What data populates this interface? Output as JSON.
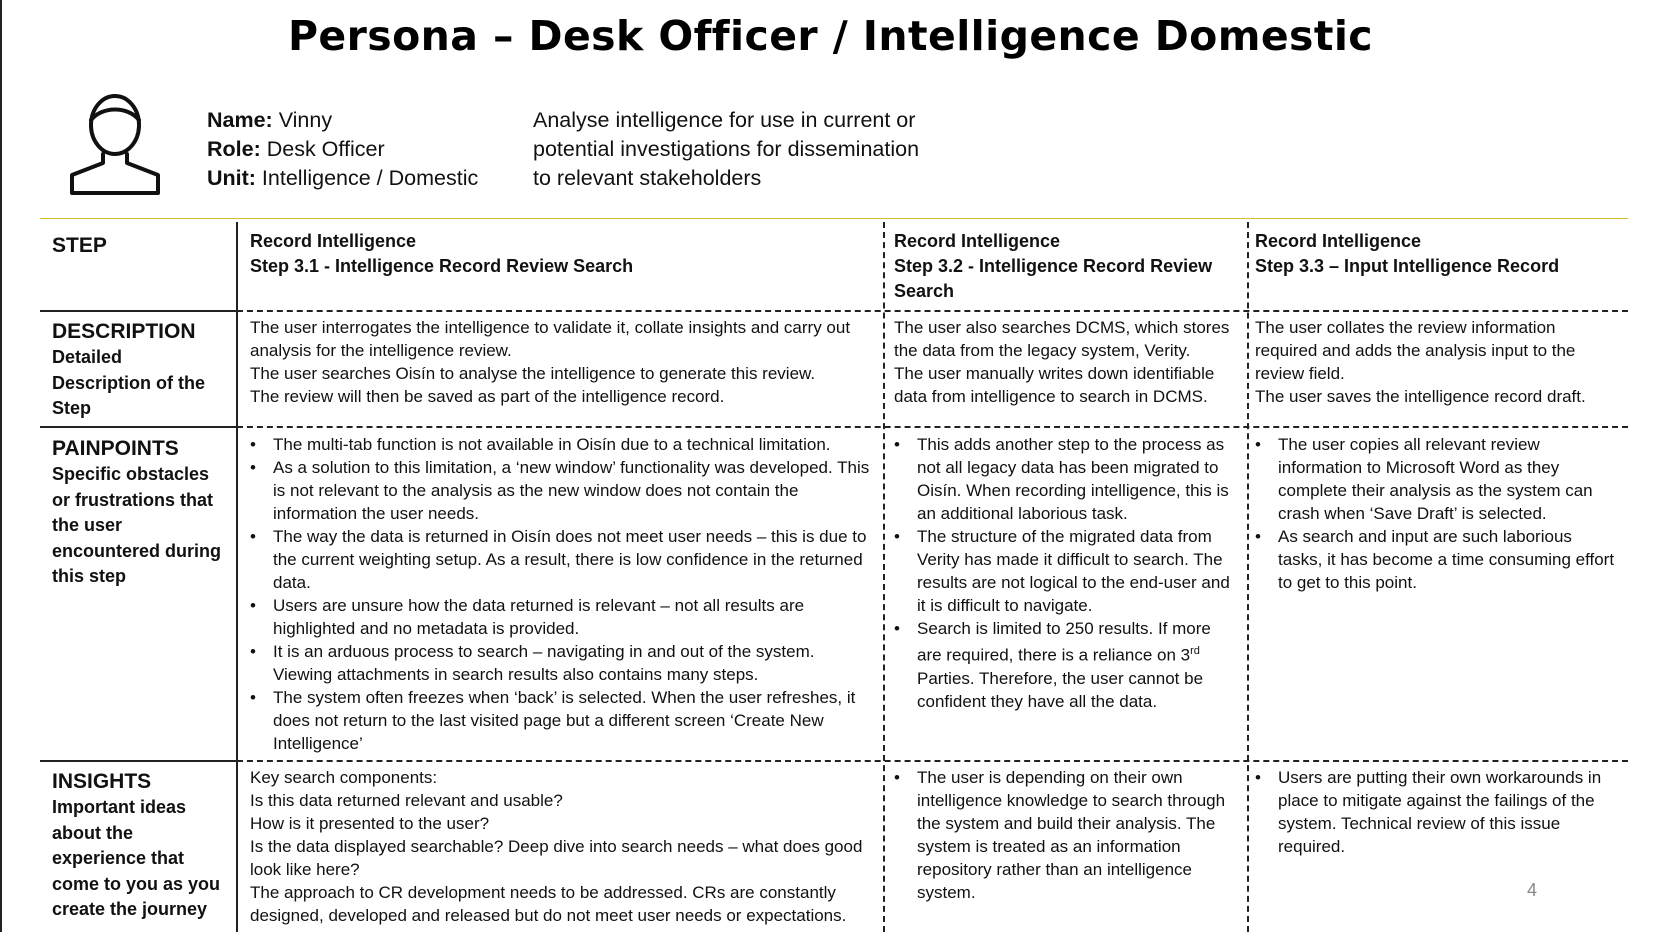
{
  "title": "Persona – Desk Officer / Intelligence Domestic",
  "persona": {
    "icon": "user-avatar-icon",
    "name_label": "Name:",
    "name_value": " Vinny",
    "role_label": "Role:",
    "role_value": " Desk Officer",
    "unit_label": "Unit:",
    "unit_value": " Intelligence / Domestic",
    "description_lines": [
      "Analyse intelligence for use in current or",
      "potential investigations for dissemination",
      "to relevant stakeholders"
    ]
  },
  "rows": {
    "step": {
      "label": "STEP"
    },
    "description": {
      "label": "DESCRIPTION",
      "sub": "Detailed Description of the Step"
    },
    "painpoints": {
      "label": "PAINPOINTS",
      "sub": "Specific obstacles or frustrations that the user encountered during this step"
    },
    "insights": {
      "label": "INSIGHTS",
      "sub": "Important ideas about the experience that come to you as you create the journey"
    }
  },
  "columns": [
    {
      "step_title": "Record Intelligence",
      "step_subtitle": "Step 3.1 - Intelligence Record Review Search",
      "description": [
        "The user interrogates the intelligence to validate it, collate insights and carry out analysis for the intelligence review.",
        "The user searches Oisín to analyse the intelligence to generate this review.",
        "The review will then be saved as part of the intelligence record."
      ],
      "painpoints": [
        "The multi-tab function is not available in Oisín due to a technical limitation.",
        "As a solution to this limitation, a ‘new window’ functionality was developed. This is not relevant to the analysis as the new window does not contain the information the user needs.",
        "The way the data is returned in Oisín does not meet user needs – this is due to the current weighting setup. As a result, there is low confidence in the returned data.",
        "Users are unsure how the data returned is relevant – not all results are highlighted and no metadata is provided.",
        "It is an arduous process to search – navigating in and out of the system. Viewing attachments in search results also contains many steps.",
        "The system often freezes when ‘back’ is selected. When the user refreshes, it does not return to the last visited page but a different screen ‘Create New Intelligence’"
      ],
      "insights": [
        "Key search components:",
        "Is this data returned relevant and usable?",
        "How is it presented to the user?",
        "Is the data displayed searchable? Deep dive into search needs – what does good look like here?",
        "The approach to CR development needs to be addressed. CRs are constantly designed, developed and released but do not meet user needs or expectations."
      ]
    },
    {
      "step_title": "Record Intelligence",
      "step_subtitle": "Step 3.2 - Intelligence Record Review Search",
      "description": [
        "The user also searches DCMS, which stores the data from the legacy system, Verity.",
        "The user manually writes down identifiable data from intelligence to search in DCMS."
      ],
      "painpoints": [
        "This adds another step to the process as not all legacy data has been migrated to Oisín. When recording intelligence, this is an additional laborious task.",
        "The structure of the migrated data from Verity has made it difficult to search. The results are not logical to the end-user and it is difficult to navigate."
      ],
      "painpoint_search": {
        "pre": "Search is limited to 250 results. If more are required, there is a reliance on 3",
        "sup": "rd",
        "post": " Parties. Therefore, the user cannot be confident they have all the data."
      },
      "insights": [
        "The user is depending on their own intelligence knowledge to search through the system and build their analysis. The system is treated as an information repository rather than an intelligence system."
      ]
    },
    {
      "step_title": "Record Intelligence",
      "step_subtitle": "Step 3.3 – Input  Intelligence Record",
      "description": [
        "The user collates the review information required and adds the analysis input to the review field.",
        "The user saves the intelligence record draft."
      ],
      "painpoints": [
        "The user copies all relevant review information to Microsoft Word as they complete their analysis as the system can crash when ‘Save Draft’ is selected.",
        "As search and input are such laborious tasks, it has become a time consuming effort to get to this point."
      ],
      "insights": [
        "Users are putting their own workarounds in place to mitigate against the failings of the system. Technical review of this issue required."
      ]
    }
  ],
  "page_number": "4"
}
